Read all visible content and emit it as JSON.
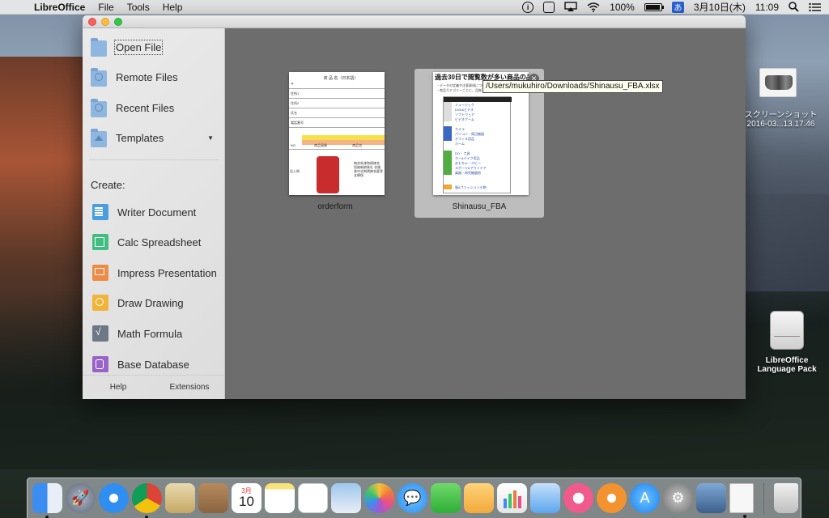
{
  "menubar": {
    "apple": "",
    "app_name": "LibreOffice",
    "menus": [
      "File",
      "Tools",
      "Help"
    ],
    "battery": "100%",
    "ime": "あ",
    "date": "3月10日(木)",
    "time": "11:09"
  },
  "sidebar": {
    "open_file": "Open File",
    "remote_files": "Remote Files",
    "recent_files": "Recent Files",
    "templates": "Templates",
    "templates_caret": "▼",
    "create_label": "Create:",
    "create_items": [
      "Writer Document",
      "Calc Spreadsheet",
      "Impress Presentation",
      "Draw Drawing",
      "Math Formula",
      "Base Database"
    ],
    "help": "Help",
    "extensions": "Extensions"
  },
  "recent": [
    {
      "name": "orderform"
    },
    {
      "name": "Shinausu_FBA",
      "tooltip": "/Users/mukuhiro/Downloads/Shinausu_FBA.xlsx",
      "close": "✕"
    }
  ],
  "orderform_preview": {
    "header": "商 品 名（日本語）",
    "rows": [
      "〒",
      "住所1",
      "住所2",
      "氏名",
      "電話番号"
    ],
    "col_no": "NO",
    "col_img": "商品画像",
    "col_name": "商品名",
    "row_label": "記入例",
    "item_text": "梅花朱漆和柄嫁衣 短袖新娘装礼 衣服装中式刺绣嫁衣夏季 支療保"
  },
  "shinausu_preview": {
    "heading": "過去30日で閲覧数が多い商品の品揃",
    "note_lines": [
      "・データの定義や注意事項については、「データの定",
      "・商品カテゴリーごとに、品揃・人気検索リストを"
    ],
    "table_header": "商品カテゴリ",
    "categories": [
      "ミュージック",
      "DVD&ビデオ",
      "ソフトウェア",
      "ビデオゲーム",
      "",
      "カメラ",
      "パソコン・周辺機器",
      "オフィス用品",
      "ホーム",
      "",
      "DIY・工具",
      "カー&バイク用品",
      "おもちゃ・ホビー",
      "スポーツ&アウトドア",
      "楽器・研究機器他",
      "",
      "服&ファッション小物"
    ]
  },
  "desktop": {
    "screenshot_label_1": "スクリーンショット",
    "screenshot_label_2": "2016-03...13.17.46",
    "pack_label_1": "LibreOffice",
    "pack_label_2": "Language Pack"
  },
  "dock": {
    "calendar_month": "3月",
    "calendar_day": "10"
  },
  "colors": {
    "writer": "#4a9ee0",
    "calc": "#3fbf7f",
    "impress": "#ee8b46",
    "draw": "#f0b43a",
    "math": "#6c7886",
    "base": "#9a63c7"
  }
}
